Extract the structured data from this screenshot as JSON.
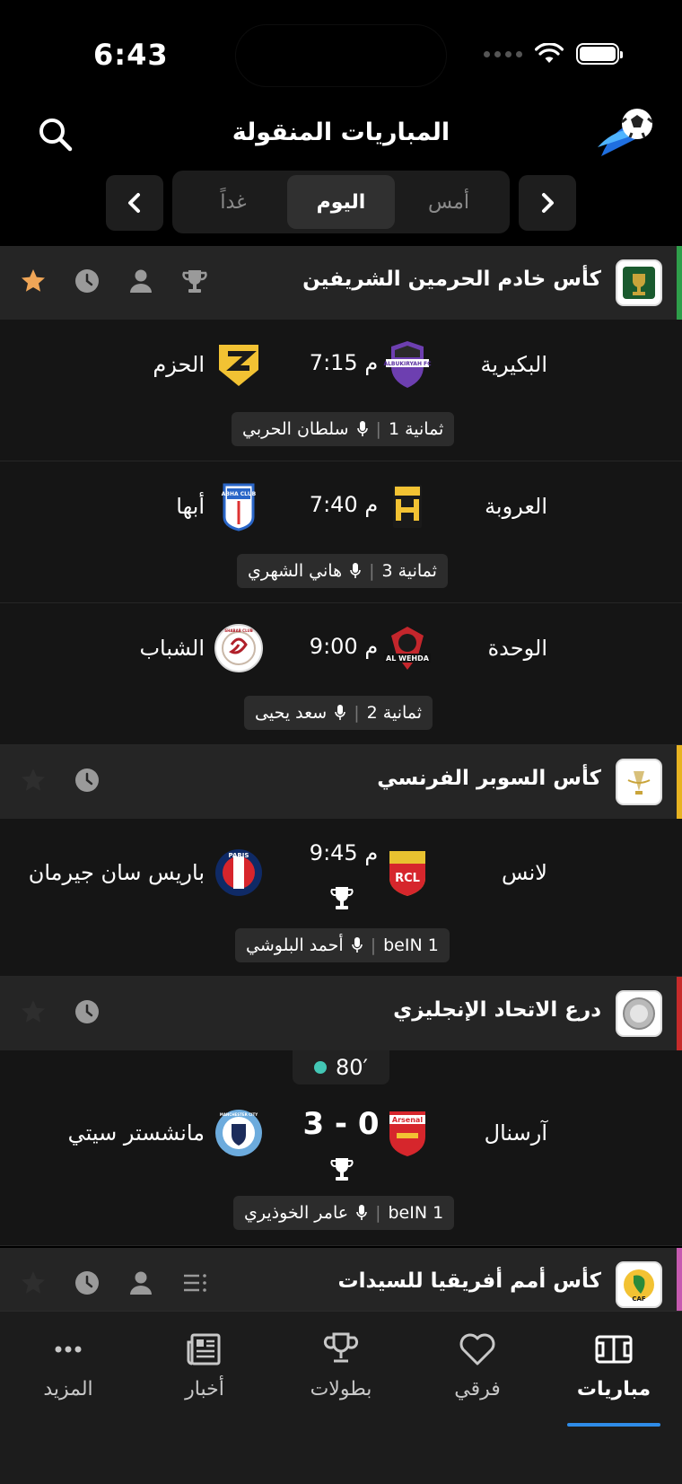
{
  "status": {
    "time": "6:43"
  },
  "header": {
    "title": "المباريات المنقولة"
  },
  "days": {
    "yesterday": "أمس",
    "today": "اليوم",
    "tomorrow": "غداً"
  },
  "leagues": [
    {
      "name": "كأس خادم الحرمين الشريفين",
      "accent": "#2e9e4a",
      "matches": [
        {
          "home": "البكيرية",
          "away": "الحزم",
          "time": "7:15 م",
          "channel": "ثمانية 1",
          "commentator": "سلطان الحربي",
          "home_logo_text": "ALBUKIRYAH FC"
        },
        {
          "home": "العروبة",
          "away": "أبها",
          "time": "7:40 م",
          "channel": "ثمانية 3",
          "commentator": "هاني الشهري",
          "away_logo_text": "ABHA CLUB"
        },
        {
          "home": "الوحدة",
          "away": "الشباب",
          "time": "9:00 م",
          "channel": "ثمانية 2",
          "commentator": "سعد يحيى",
          "home_logo_text": "AL WEHDA",
          "away_logo_text": "SHABAB CLUB"
        }
      ]
    },
    {
      "name": "كأس السوبر الفرنسي",
      "accent": "#e8b321",
      "matches": [
        {
          "home": "لانس",
          "away": "باريس سان جيرمان",
          "time": "9:45 م",
          "channel": "beIN 1",
          "commentator": "أحمد البلوشي",
          "home_logo_text": "RCL",
          "away_logo_text": "PARIS"
        }
      ]
    },
    {
      "name": "درع الاتحاد الإنجليزي",
      "accent": "#c62b2b",
      "matches": [
        {
          "home": "آرسنال",
          "away": "مانشستر سيتي",
          "score": "3 - 0",
          "minute": "80′",
          "channel": "beIN 1",
          "commentator": "عامر الخوذيري",
          "home_logo_text": "Arsenal",
          "away_logo_text": "MANCHESTER CITY"
        }
      ]
    },
    {
      "name": "كأس أمم أفريقيا للسيدات",
      "accent": "#c65ab0",
      "logo_text": "CAF"
    }
  ],
  "tabs": [
    {
      "label": "مباريات"
    },
    {
      "label": "فرقي"
    },
    {
      "label": "بطولات"
    },
    {
      "label": "أخبار"
    },
    {
      "label": "المزيد"
    }
  ]
}
